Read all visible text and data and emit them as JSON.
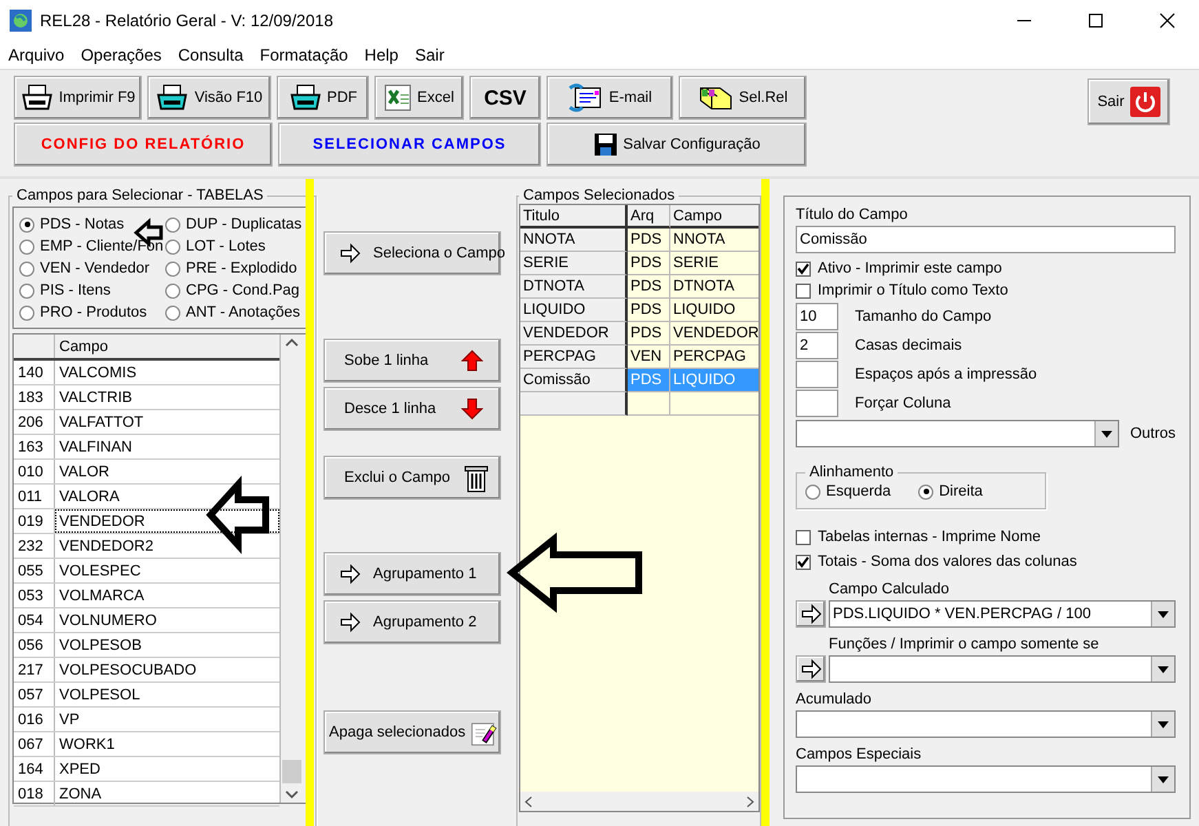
{
  "window": {
    "title": "REL28 - Relatório Geral - V: 12/09/2018"
  },
  "menu": [
    "Arquivo",
    "Operações",
    "Consulta",
    "Formatação",
    "Help",
    "Sair"
  ],
  "toolbar": [
    {
      "label": "Imprimir F9",
      "kind": "print"
    },
    {
      "label": "Visão F10",
      "kind": "preview"
    },
    {
      "label": "PDF",
      "kind": "pdf"
    },
    {
      "label": "Excel",
      "kind": "excel"
    },
    {
      "label": "CSV",
      "kind": "csv"
    },
    {
      "label": "E-mail",
      "kind": "mail"
    },
    {
      "label": "Sel.Rel",
      "kind": "select"
    }
  ],
  "toolbar2": [
    {
      "label": "CONFIG DO RELATÓRIO",
      "kind": "tab",
      "color": "#ff0000"
    },
    {
      "label": "SELECIONAR CAMPOS",
      "kind": "tab",
      "color": "#0000ff"
    },
    {
      "label": "Salvar Configuração",
      "kind": "save"
    }
  ],
  "exit_button": {
    "label": "Sair"
  },
  "tables_panel": {
    "title": "Campos para Selecionar  - TABELAS",
    "tables": [
      {
        "label": "PDS - Notas",
        "selected": true
      },
      {
        "label": "DUP - Duplicatas",
        "selected": false
      },
      {
        "label": "EMP - Cliente/Fon",
        "selected": false
      },
      {
        "label": "LOT - Lotes",
        "selected": false
      },
      {
        "label": "VEN - Vendedor",
        "selected": false
      },
      {
        "label": "PRE - Explodido",
        "selected": false
      },
      {
        "label": "PIS - Itens",
        "selected": false
      },
      {
        "label": "CPG - Cond.Pag",
        "selected": false
      },
      {
        "label": "PRO - Produtos",
        "selected": false
      },
      {
        "label": "ANT - Anotações",
        "selected": false
      }
    ],
    "column": "Campo",
    "fields": [
      {
        "code": "140",
        "name": "VALCOMIS",
        "focused": false
      },
      {
        "code": "183",
        "name": "VALCTRIB",
        "focused": false
      },
      {
        "code": "206",
        "name": "VALFATTOT",
        "focused": false
      },
      {
        "code": "163",
        "name": "VALFINAN",
        "focused": false
      },
      {
        "code": "010",
        "name": "VALOR",
        "focused": false
      },
      {
        "code": "011",
        "name": "VALORA",
        "focused": false
      },
      {
        "code": "019",
        "name": "VENDEDOR",
        "focused": true
      },
      {
        "code": "232",
        "name": "VENDEDOR2",
        "focused": false
      },
      {
        "code": "055",
        "name": "VOLESPEC",
        "focused": false
      },
      {
        "code": "053",
        "name": "VOLMARCA",
        "focused": false
      },
      {
        "code": "054",
        "name": "VOLNUMERO",
        "focused": false
      },
      {
        "code": "056",
        "name": "VOLPESOB",
        "focused": false
      },
      {
        "code": "217",
        "name": "VOLPESOCUBADO",
        "focused": false
      },
      {
        "code": "057",
        "name": "VOLPESOL",
        "focused": false
      },
      {
        "code": "016",
        "name": "VP",
        "focused": false
      },
      {
        "code": "067",
        "name": "WORK1",
        "focused": false
      },
      {
        "code": "164",
        "name": "XPED",
        "focused": false
      },
      {
        "code": "018",
        "name": "ZONA",
        "focused": false
      }
    ]
  },
  "actions": [
    [
      {
        "label": "Seleciona o Campo",
        "kind": "select"
      }
    ],
    [
      {
        "label": "Sobe 1 linha",
        "kind": "up"
      },
      {
        "label": "Desce 1 linha",
        "kind": "down"
      }
    ],
    [
      {
        "label": "Exclui o Campo",
        "kind": "delete"
      }
    ],
    [
      {
        "label": "Agrupamento 1",
        "kind": "group"
      },
      {
        "label": "Agrupamento 2",
        "kind": "group"
      }
    ],
    [
      {
        "label": "Apaga selecionados",
        "kind": "clear"
      }
    ]
  ],
  "selected_panel": {
    "title": "Campos Selecionados",
    "columns": [
      "Titulo",
      "Arq",
      "Campo"
    ],
    "rows": [
      {
        "title": "NNOTA",
        "arq": "PDS",
        "campo": "NNOTA",
        "selected": false
      },
      {
        "title": "SERIE",
        "arq": "PDS",
        "campo": "SERIE",
        "selected": false
      },
      {
        "title": "DTNOTA",
        "arq": "PDS",
        "campo": "DTNOTA",
        "selected": false
      },
      {
        "title": "LIQUIDO",
        "arq": "PDS",
        "campo": "LIQUIDO",
        "selected": false
      },
      {
        "title": "VENDEDOR",
        "arq": "PDS",
        "campo": "VENDEDOR",
        "selected": false
      },
      {
        "title": "PERCPAG",
        "arq": "VEN",
        "campo": "PERCPAG",
        "selected": false
      },
      {
        "title": "Comissão",
        "arq": "PDS",
        "campo": "LIQUIDO",
        "selected": true
      }
    ]
  },
  "field_panel": {
    "title_label": "Título do Campo",
    "title_value": "Comissão",
    "options": [
      {
        "label": "Ativo - Imprimir este campo",
        "checked": true
      },
      {
        "label": "Imprimir o Título como Texto",
        "checked": false
      }
    ],
    "numbers": [
      {
        "label": "Tamanho do Campo",
        "value": "10"
      },
      {
        "label": "Casas decimais",
        "value": "2"
      },
      {
        "label": "Espaços após a impressão"
      },
      {
        "label": "Forçar Coluna"
      }
    ],
    "others_label": "Outros",
    "alignment": {
      "title": "Alinhamento",
      "options": [
        {
          "label": "Esquerda",
          "selected": false
        },
        {
          "label": "Direita",
          "selected": true
        }
      ]
    },
    "options2": [
      {
        "label": "Tabelas internas - Imprime Nome",
        "checked": false
      },
      {
        "label": "Totais - Soma dos valores das colunas",
        "checked": true
      }
    ],
    "combos": [
      {
        "label": "Campo Calculado",
        "value": "PDS.LIQUIDO * VEN.PERCPAG / 100",
        "arrow_button": true
      },
      {
        "label": "Funções / Imprimir o campo somente se",
        "arrow_button": true
      },
      {
        "label": "Acumulado",
        "arrow_button": false
      },
      {
        "label": "Campos Especiais",
        "arrow_button": false
      }
    ]
  }
}
